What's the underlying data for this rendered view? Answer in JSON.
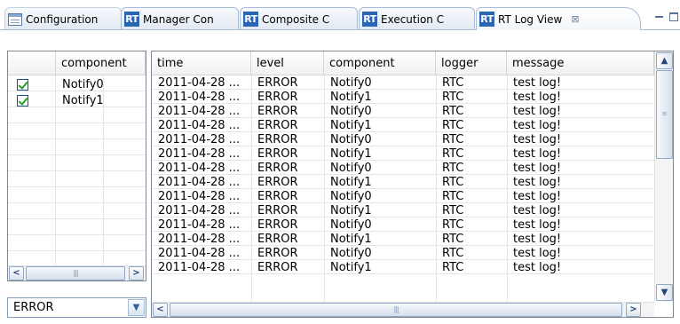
{
  "tabs": [
    {
      "label": "Configuration",
      "icon": "configuration-icon"
    },
    {
      "label": "Manager Con",
      "icon": "rt-icon"
    },
    {
      "label": "Composite C",
      "icon": "rt-icon"
    },
    {
      "label": "Execution C",
      "icon": "rt-icon"
    },
    {
      "label": "RT Log View",
      "icon": "rt-icon",
      "active": true,
      "close": "⊠"
    }
  ],
  "rt_icon_text": "RT",
  "components_panel": {
    "header": "component",
    "items": [
      {
        "name": "Notify0",
        "checked": true
      },
      {
        "name": "Notify1",
        "checked": true
      }
    ]
  },
  "level_filter": {
    "value": "ERROR"
  },
  "log_table": {
    "columns": [
      "time",
      "level",
      "component",
      "logger",
      "message"
    ],
    "rows": [
      [
        "2011-04-28 ...",
        "ERROR",
        "Notify0",
        "RTC",
        "test log!"
      ],
      [
        "2011-04-28 ...",
        "ERROR",
        "Notify1",
        "RTC",
        "test log!"
      ],
      [
        "2011-04-28 ...",
        "ERROR",
        "Notify0",
        "RTC",
        "test log!"
      ],
      [
        "2011-04-28 ...",
        "ERROR",
        "Notify1",
        "RTC",
        "test log!"
      ],
      [
        "2011-04-28 ...",
        "ERROR",
        "Notify0",
        "RTC",
        "test log!"
      ],
      [
        "2011-04-28 ...",
        "ERROR",
        "Notify1",
        "RTC",
        "test log!"
      ],
      [
        "2011-04-28 ...",
        "ERROR",
        "Notify0",
        "RTC",
        "test log!"
      ],
      [
        "2011-04-28 ...",
        "ERROR",
        "Notify1",
        "RTC",
        "test log!"
      ],
      [
        "2011-04-28 ...",
        "ERROR",
        "Notify0",
        "RTC",
        "test log!"
      ],
      [
        "2011-04-28 ...",
        "ERROR",
        "Notify1",
        "RTC",
        "test log!"
      ],
      [
        "2011-04-28 ...",
        "ERROR",
        "Notify0",
        "RTC",
        "test log!"
      ],
      [
        "2011-04-28 ...",
        "ERROR",
        "Notify1",
        "RTC",
        "test log!"
      ],
      [
        "2011-04-28 ...",
        "ERROR",
        "Notify0",
        "RTC",
        "test log!"
      ],
      [
        "2011-04-28 ...",
        "ERROR",
        "Notify1",
        "RTC",
        "test log!"
      ]
    ]
  },
  "colors": {
    "rt_icon": "#2a66b4",
    "tab_border": "#a9bcd3",
    "checkmark": "#21a121"
  }
}
